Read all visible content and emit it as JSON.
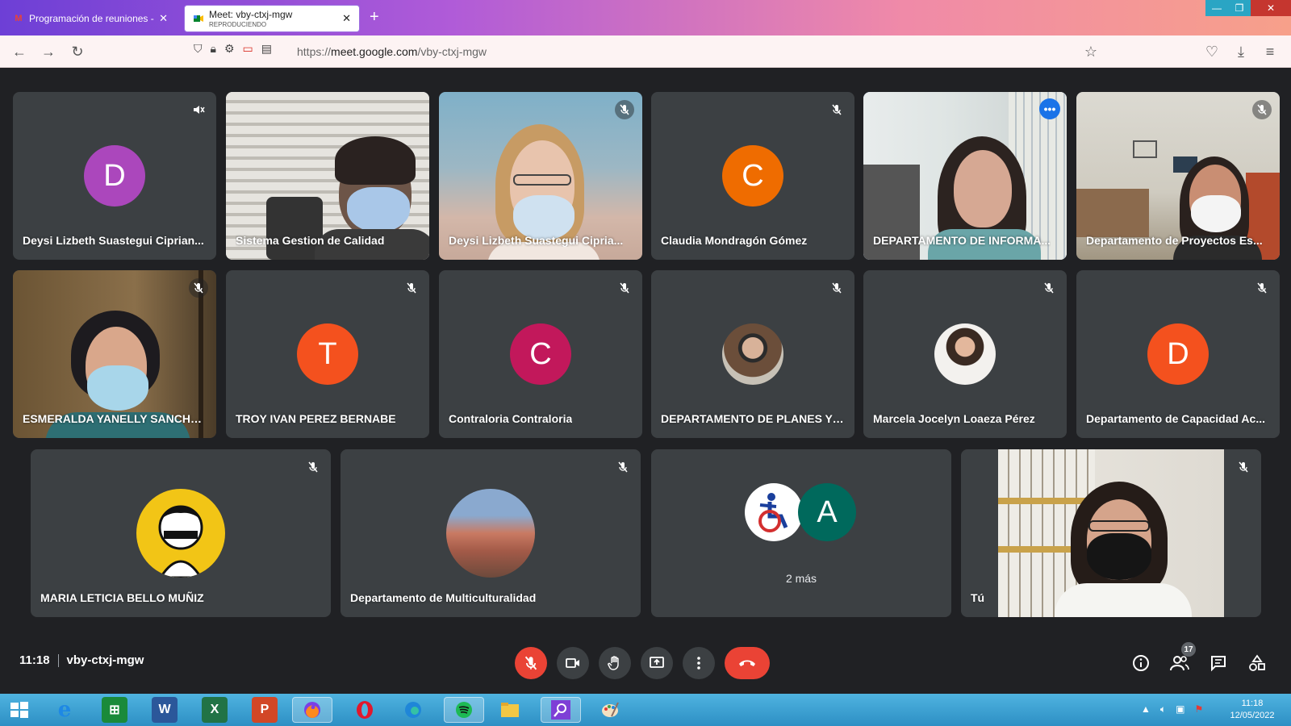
{
  "browser": {
    "tabs": [
      {
        "title": "Programación de reuniones - m",
        "sub": ""
      },
      {
        "title": "Meet: vby-ctxj-mgw",
        "sub": "REPRODUCIENDO"
      }
    ],
    "url_prefix": "https://",
    "url_host": "meet.google.com",
    "url_path": "/vby-ctxj-mgw"
  },
  "tiles": [
    {
      "name": "Deysi Lizbeth Suastegui Ciprian...",
      "initial": "D",
      "color": "#ab47bc"
    },
    {
      "name": "Sistema Gestion de Calidad"
    },
    {
      "name": "Deysi Lizbeth Suastegui Cipria..."
    },
    {
      "name": "Claudia Mondragón Gómez",
      "initial": "C",
      "color": "#ef6c00"
    },
    {
      "name": "DEPARTAMENTO DE INFORMA..."
    },
    {
      "name": "Departamento de Proyectos Es..."
    },
    {
      "name": "ESMERALDA YANELLY SANCHE..."
    },
    {
      "name": "TROY IVAN PEREZ BERNABE",
      "initial": "T",
      "color": "#f4511e"
    },
    {
      "name": "Contraloria Contraloria",
      "initial": "C",
      "color": "#c2185b"
    },
    {
      "name": "DEPARTAMENTO DE PLANES Y P..."
    },
    {
      "name": "Marcela Jocelyn Loaeza Pérez"
    },
    {
      "name": "Departamento de Capacidad Ac...",
      "initial": "D",
      "color": "#f4511e"
    },
    {
      "name": "MARIA LETICIA BELLO MUÑIZ"
    },
    {
      "name": "Departamento de Multiculturalidad"
    },
    {
      "name": "",
      "more": "2 más",
      "initial": "A",
      "color": "#00695c"
    },
    {
      "name": "Tú"
    }
  ],
  "meeting": {
    "time": "11:18",
    "code": "vby-ctxj-mgw",
    "participants_count": "17"
  },
  "taskbar": {
    "clock_time": "11:18",
    "clock_date": "12/05/2022"
  },
  "colors": {
    "meet_bg": "#202124",
    "tile_bg": "#3c4043",
    "danger": "#ea4335",
    "active_outline": "#8ab4f8"
  }
}
